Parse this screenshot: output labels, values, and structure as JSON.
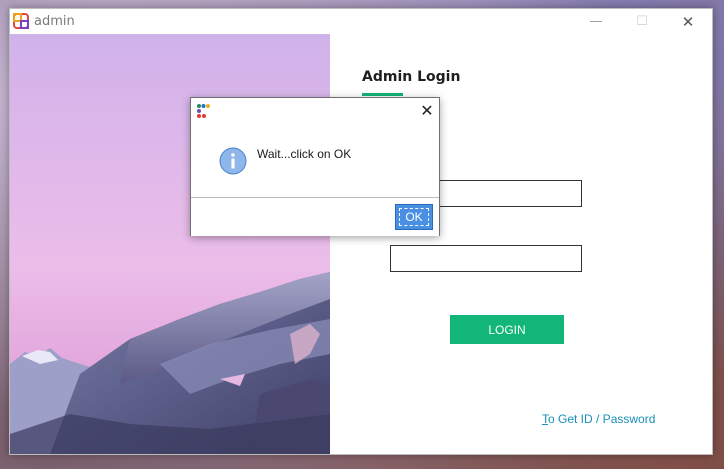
{
  "window": {
    "title": "admin",
    "controls": {
      "minimize": "—",
      "maximize": "☐",
      "close": "✕"
    }
  },
  "login": {
    "title": "Admin Login",
    "button_label": "LOGIN",
    "forgot_prefix": "T",
    "forgot_rest": "o Get ID / Password",
    "accent": "#13b679",
    "link_color": "#1a8fb8"
  },
  "dialog": {
    "message": "Wait...click on OK",
    "ok_label": "OK",
    "close": "✕",
    "icon": "info-icon"
  }
}
